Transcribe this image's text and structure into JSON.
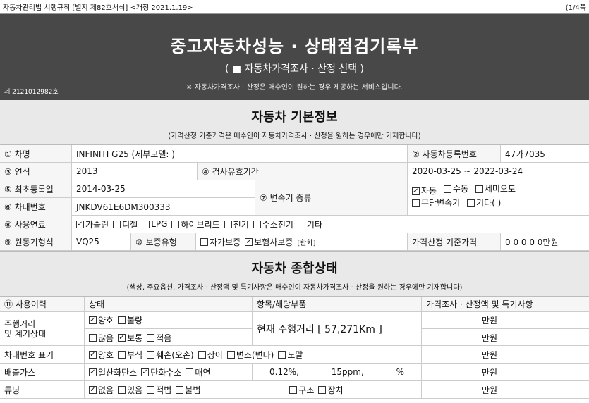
{
  "topline": {
    "left": "자동차관리법 시행규칙 [별지 제82호서식] <개정 2021.1.19>",
    "right": "(1/4쪽"
  },
  "header": {
    "title": "중고자동차성능 · 상태점검기록부",
    "subtitle": "( ■ 자동차가격조사 · 산정 선택 )",
    "note": "※ 자동차가격조사 · 산정은 매수인이 원하는 경우 제공하는 서비스입니다.",
    "doc_no": "제 2121012982호"
  },
  "basic": {
    "title": "자동차 기본정보",
    "note": "(가격산정 기준가격은 매수인이 자동차가격조사 · 산정을 원하는 경우에만 기재합니다)",
    "name_label": "① 차명",
    "name_value": "INFINITI G25 (세부모델: )",
    "reg_label": "② 자동차등록번호",
    "reg_value": "47가7035",
    "year_label": "③ 연식",
    "year_value": "2013",
    "insp_label": "④ 검사유효기간",
    "insp_value": "2020-03-25 ~ 2022-03-24",
    "first_reg_label": "⑤ 최초등록일",
    "first_reg_value": "2014-03-25",
    "trans_label": "⑦ 변속기 종류",
    "trans_opts": [
      "자동",
      "수동",
      "세미오토",
      "무단변속기",
      "기타(      )"
    ],
    "vin_label": "⑥ 차대번호",
    "vin_value": "JNKDV61E6DM300333",
    "fuel_label": "⑧ 사용연료",
    "fuel_opts": [
      "가솔린",
      "디젤",
      "LPG",
      "하이브리드",
      "전기",
      "수소전기",
      "기타"
    ],
    "engine_label": "⑨ 원동기형식",
    "engine_value": "VQ25",
    "warranty_label": "⑩ 보증유형",
    "warranty_opts": [
      "자가보증",
      "보험사보증"
    ],
    "warranty_note": "[한화]",
    "price_label": "가격산정 기준가격",
    "price_value": "0 0 0 0 0만원"
  },
  "overall": {
    "title": "자동차 종합상태",
    "note": "(색상, 주요옵션, 가격조사 · 산정액 및 특기사항은 매수인이 자동차가격조사 · 산정을 원하는 경우에만 기재합니다)",
    "col_usage": "⑪ 사용이력",
    "col_state": "상태",
    "col_item": "항목/해당부품",
    "col_price": "가격조사 · 산정액 및 특기사항",
    "mileage_label": "주행거리\n및 계기상태",
    "mileage_opts1": [
      "양호",
      "불량"
    ],
    "mileage_opts2": [
      "많음",
      "보통",
      "적음"
    ],
    "mileage_text": "현재 주행거리 [ 57,271Km ]",
    "unit": "만원",
    "vin_state_label": "차대번호 표기",
    "vin_state_opts": [
      "양호",
      "부식",
      "훼손(오손)",
      "상이",
      "변조(변타)",
      "도말"
    ],
    "emission_label": "배출가스",
    "emission_opts": [
      "일산화탄소",
      "탄화수소",
      "매연"
    ],
    "emission_v1": "0.12%,",
    "emission_v2": "15ppm,",
    "emission_v3": "%",
    "tuning_label": "튜닝",
    "tuning_opts": [
      "없음",
      "있음"
    ],
    "tuning_opts2": [
      "적법",
      "불법"
    ],
    "tuning_opts3": [
      "구조",
      "장치"
    ]
  }
}
